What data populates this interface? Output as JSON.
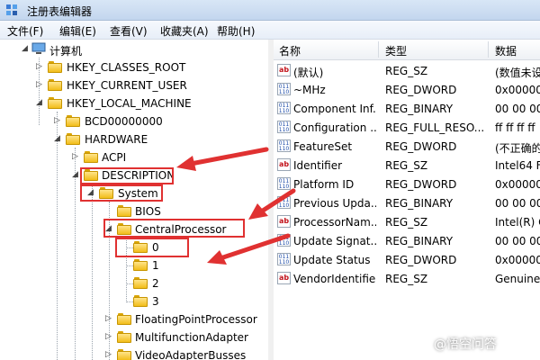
{
  "window": {
    "title": "注册表编辑器"
  },
  "menu": [
    "文件(F)",
    "编辑(E)",
    "查看(V)",
    "收藏夹(A)",
    "帮助(H)"
  ],
  "tree": {
    "root": "计算机",
    "hkcr": "HKEY_CLASSES_ROOT",
    "hkcu": "HKEY_CURRENT_USER",
    "hklm": "HKEY_LOCAL_MACHINE",
    "bcd": "BCD00000000",
    "hardware": "HARDWARE",
    "acpi": "ACPI",
    "description": "DESCRIPTION",
    "system": "System",
    "bios": "BIOS",
    "cpu": "CentralProcessor",
    "cpu0": "0",
    "cpu1": "1",
    "cpu2": "2",
    "cpu3": "3",
    "fpp": "FloatingPointProcessor",
    "mfa": "MultifunctionAdapter",
    "vab": "VideoAdapterBusses"
  },
  "columns": {
    "name": "名称",
    "type": "类型",
    "data": "数据"
  },
  "rows": [
    {
      "name": "(默认)",
      "type": "REG_SZ",
      "data": "(数值未设",
      "icon": "string-value-icon"
    },
    {
      "name": "~MHz",
      "type": "REG_DWORD",
      "data": "0x000004",
      "icon": "binary-value-icon"
    },
    {
      "name": "Component Inf...",
      "type": "REG_BINARY",
      "data": "00 00 00",
      "icon": "binary-value-icon"
    },
    {
      "name": "Configuration ...",
      "type": "REG_FULL_RESO...",
      "data": "ff ff ff ff",
      "icon": "binary-value-icon"
    },
    {
      "name": "FeatureSet",
      "type": "REG_DWORD",
      "data": "(不正确的",
      "icon": "binary-value-icon"
    },
    {
      "name": "Identifier",
      "type": "REG_SZ",
      "data": "Intel64 F",
      "icon": "string-value-icon"
    },
    {
      "name": "Platform ID",
      "type": "REG_DWORD",
      "data": "0x000000",
      "icon": "binary-value-icon"
    },
    {
      "name": "Previous Upda...",
      "type": "REG_BINARY",
      "data": "00 00 00",
      "icon": "binary-value-icon"
    },
    {
      "name": "ProcessorNam...",
      "type": "REG_SZ",
      "data": "Intel(R) C",
      "icon": "string-value-icon"
    },
    {
      "name": "Update Signat...",
      "type": "REG_BINARY",
      "data": "00 00 00",
      "icon": "binary-value-icon"
    },
    {
      "name": "Update Status",
      "type": "REG_DWORD",
      "data": "0x000000",
      "icon": "binary-value-icon"
    },
    {
      "name": "VendorIdentifier",
      "type": "REG_SZ",
      "data": "GenuineI",
      "icon": "string-value-icon"
    }
  ],
  "annotation_color": "#e03131",
  "watermark": "@悟空问答"
}
